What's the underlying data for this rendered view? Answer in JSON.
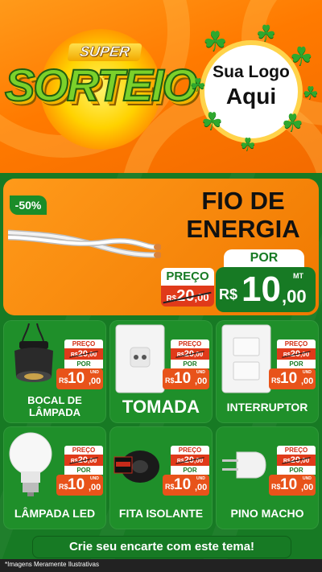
{
  "header": {
    "logo_super": "SUPER",
    "logo_sorteio": "SORTEIO",
    "logo_line1": "Sua Logo",
    "logo_line2": "Aqui"
  },
  "hero": {
    "discount": "-50%",
    "title_line1": "FIO DE",
    "title_line2": "ENERGIA",
    "preco_label": "PREÇO",
    "old_currency": "R$",
    "old_int": "20",
    "old_cents": ",00",
    "por_label": "POR",
    "unit": "MT",
    "new_currency": "R$",
    "new_int": "10",
    "new_cents": ",00"
  },
  "products": [
    {
      "name_line1": "BOCAL DE",
      "name_line2": "LÂMPADA",
      "preco_label": "PREÇO",
      "old_currency": "R$",
      "old_int": "20",
      "old_cents": ",00",
      "por_label": "POR",
      "unit": "UND",
      "currency": "R$",
      "int": "10",
      "cents": ",00"
    },
    {
      "name_line1": "TOMADA",
      "preco_label": "PREÇO",
      "old_currency": "R$",
      "old_int": "20",
      "old_cents": ",00",
      "por_label": "POR",
      "unit": "UND",
      "currency": "R$",
      "int": "10",
      "cents": ",00"
    },
    {
      "name_line1": "INTERRUPTOR",
      "preco_label": "PREÇO",
      "old_currency": "R$",
      "old_int": "20",
      "old_cents": ",00",
      "por_label": "POR",
      "unit": "UND",
      "currency": "R$",
      "int": "10",
      "cents": ",00"
    },
    {
      "name_line1": "LÂMPADA LED",
      "preco_label": "PREÇO",
      "old_currency": "R$",
      "old_int": "20",
      "old_cents": ",00",
      "por_label": "POR",
      "unit": "UND",
      "currency": "R$",
      "int": "10",
      "cents": ",00"
    },
    {
      "name_line1": "FITA ISOLANTE",
      "preco_label": "PREÇO",
      "old_currency": "R$",
      "old_int": "20",
      "old_cents": ",00",
      "por_label": "POR",
      "unit": "UND",
      "currency": "R$",
      "int": "10",
      "cents": ",00"
    },
    {
      "name_line1": "PINO MACHO",
      "preco_label": "PREÇO",
      "old_currency": "R$",
      "old_int": "20",
      "old_cents": ",00",
      "por_label": "POR",
      "unit": "UND",
      "currency": "R$",
      "int": "10",
      "cents": ",00"
    }
  ],
  "cta": "Crie seu encarte com este tema!",
  "note": "*Imagens Meramente Ilustrativas",
  "colors": {
    "orange": "#ff7a00",
    "green": "#177a24",
    "red": "#e03a1a",
    "yellow": "#ffd200"
  }
}
